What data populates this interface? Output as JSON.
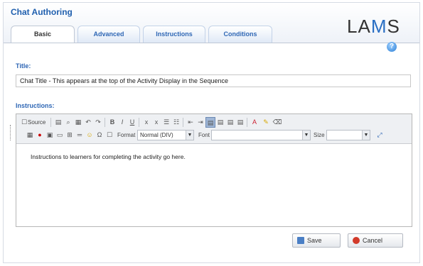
{
  "app": {
    "title": "Chat Authoring",
    "logo": {
      "left": "LA",
      "middle": "M",
      "right": "S"
    }
  },
  "tabs": [
    {
      "label": "Basic",
      "active": true
    },
    {
      "label": "Advanced",
      "active": false
    },
    {
      "label": "Instructions",
      "active": false
    },
    {
      "label": "Conditions",
      "active": false
    }
  ],
  "help": {
    "glyph": "?"
  },
  "form": {
    "title_label": "Title:",
    "title_value": "Chat Title - This appears at the top of the Activity Display in the Sequence",
    "instructions_label": "Instructions:"
  },
  "editor": {
    "toolbar": {
      "source_label": "Source",
      "format_label": "Format",
      "format_value": "Normal (DIV)",
      "font_label": "Font",
      "font_value": "",
      "size_label": "Size",
      "size_value": ""
    },
    "content": "Instructions to learners for completing the activity go here."
  },
  "actions": {
    "save_label": "Save",
    "cancel_label": "Cancel"
  },
  "colors": {
    "accent": "#2f67b5",
    "title": "#1f5fae"
  }
}
